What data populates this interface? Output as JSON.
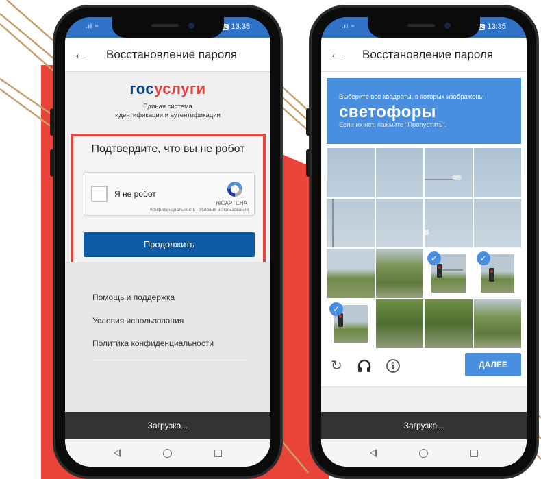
{
  "colors": {
    "accent_red": "#e8443a",
    "gosuslugi_blue": "#0d4a8f",
    "button_blue": "#0d5aa7",
    "captcha_blue": "#4a8ee0",
    "status_blue": "#2f72c8"
  },
  "status_bar": {
    "battery": "62",
    "time": "13:35"
  },
  "left_phone": {
    "title": "Восстановление пароля",
    "logo_part1": "гос",
    "logo_part2": "услуги",
    "logo_subtitle_line1": "Единая система",
    "logo_subtitle_line2": "идентификации и аутентификации",
    "confirm_title": "Подтвердите, что вы не робот",
    "recaptcha": {
      "checkbox_label": "Я не робот",
      "brand": "reCAPTCHA",
      "links": "Конфиденциальность - Условия использования"
    },
    "continue_button": "Продолжить",
    "footer_links": [
      "Помощь и поддержка",
      "Условия использования",
      "Политика конфиденциальности"
    ],
    "loading_text": "Загрузка..."
  },
  "right_phone": {
    "title": "Восстановление пароля",
    "captcha": {
      "instruction_top": "Выберите все квадраты, в которых изображены",
      "target_word": "светофоры",
      "instruction_bottom": "Если их нет, нажмите \"Пропустить\".",
      "selected_tiles": [
        10,
        11,
        12
      ],
      "icons": [
        "reload-icon",
        "headphones-icon",
        "info-icon"
      ],
      "next_button": "ДАЛЕЕ"
    },
    "loading_text": "Загрузка..."
  }
}
